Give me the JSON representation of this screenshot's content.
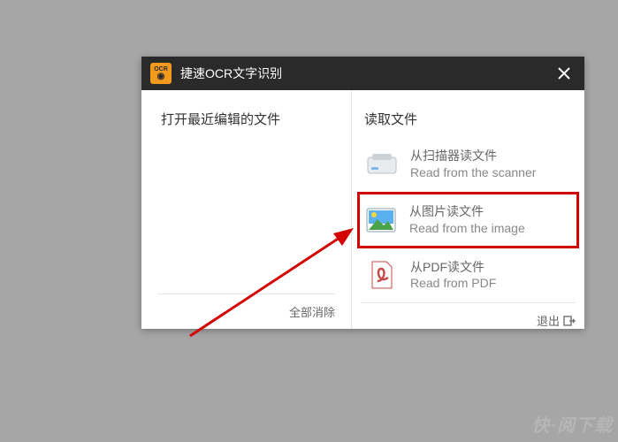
{
  "title": "捷速OCR文字识别",
  "badge": "OCR",
  "left": {
    "heading": "打开最近编辑的文件",
    "clear_all": "全部消除"
  },
  "right": {
    "heading": "读取文件",
    "options": [
      {
        "zh": "从扫描器读文件",
        "en": "Read from the scanner"
      },
      {
        "zh": "从图片读文件",
        "en": "Read from the image"
      },
      {
        "zh": "从PDF读文件",
        "en": "Read from PDF"
      }
    ],
    "exit": "退出"
  },
  "watermark": "快·阅下载"
}
